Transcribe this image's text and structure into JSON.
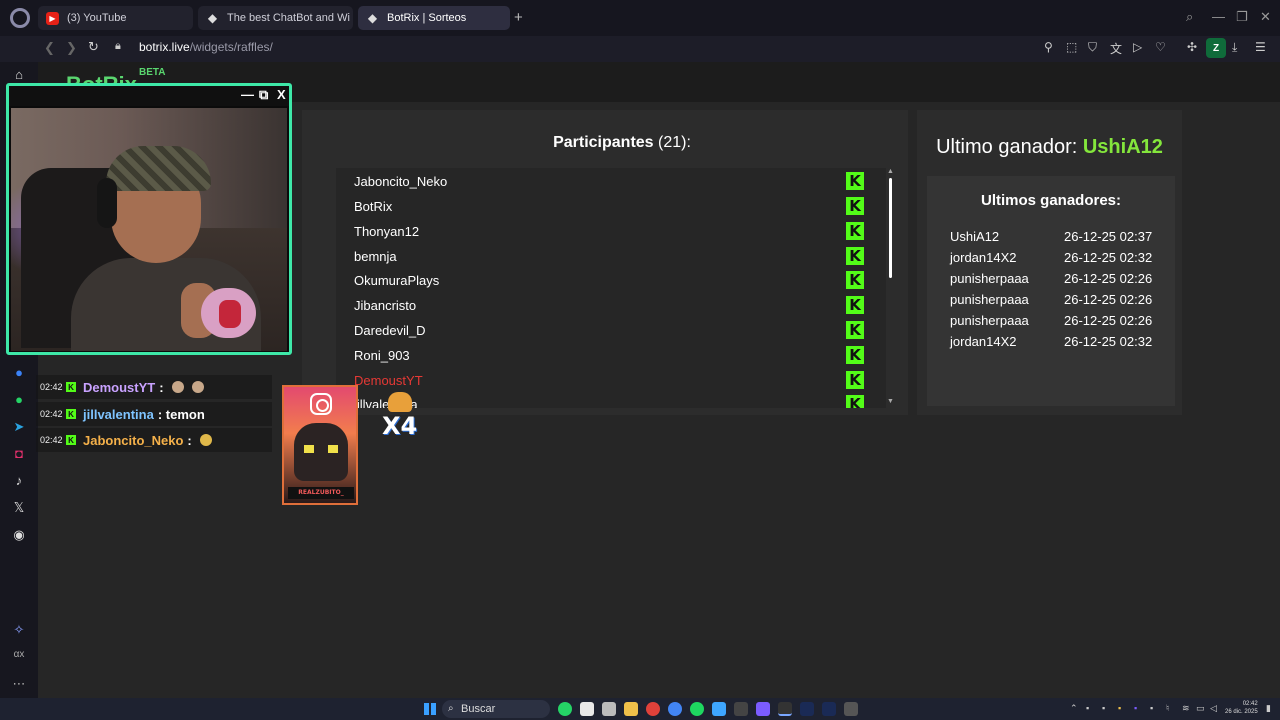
{
  "browser": {
    "tabs": [
      {
        "title": "(3) YouTube",
        "favicon": "youtube-icon"
      },
      {
        "title": "The best ChatBot and Wi",
        "favicon": "botrix-icon"
      },
      {
        "title": "BotRix | Sorteos",
        "favicon": "botrix-icon",
        "active": true
      }
    ],
    "url_host": "botrix.live",
    "url_path": "/widgets/raffles/",
    "profile_initial": "Z"
  },
  "page": {
    "brand": "BotRix",
    "beta": "BETA"
  },
  "participants": {
    "label": "Participantes",
    "count_text": "(21):",
    "items": [
      "Jaboncito_Neko",
      "BotRix",
      "Thonyan12",
      "bemnja",
      "OkumuraPlays",
      "Jibancristo",
      "Daredevil_D",
      "Roni_903",
      "DemoustYT",
      "jillvalentina"
    ],
    "highlight_color": "#e53935"
  },
  "winner": {
    "label": "Ultimo ganador:",
    "name": "UshiA12",
    "list_title": "Ultimos ganadores:",
    "history": [
      {
        "name": "UshiA12",
        "time": "26-12-25 02:37"
      },
      {
        "name": "jordan14X2",
        "time": "26-12-25 02:32"
      },
      {
        "name": "punisherpaaa",
        "time": "26-12-25 02:26"
      },
      {
        "name": "punisherpaaa",
        "time": "26-12-25 02:26"
      },
      {
        "name": "punisherpaaa",
        "time": "26-12-25 02:26"
      },
      {
        "name": "jordan14X2",
        "time": "26-12-25 02:32"
      }
    ]
  },
  "webcam": {
    "minimize": "—",
    "restore": "⧉",
    "close": "X"
  },
  "chat": [
    {
      "time": "02:42",
      "user": "DemoustYT",
      "message": ":",
      "color": "#c9a2ff"
    },
    {
      "time": "02:42",
      "user": "jillvalentina",
      "message": ": temon",
      "color": "#7fc4ff"
    },
    {
      "time": "02:42",
      "user": "Jaboncito_Neko",
      "message": ":",
      "color": "#f5b14a"
    }
  ],
  "overlay": {
    "instagram_name": "REALZUBITO_",
    "multiplier": "X4"
  },
  "taskbar": {
    "search_label": "Buscar",
    "time": "02:42",
    "date": "26 dic. 2025"
  },
  "colors": {
    "accent_green": "#84e63c",
    "kick_green": "#53fc18",
    "cam_border": "#3ee8a8"
  }
}
